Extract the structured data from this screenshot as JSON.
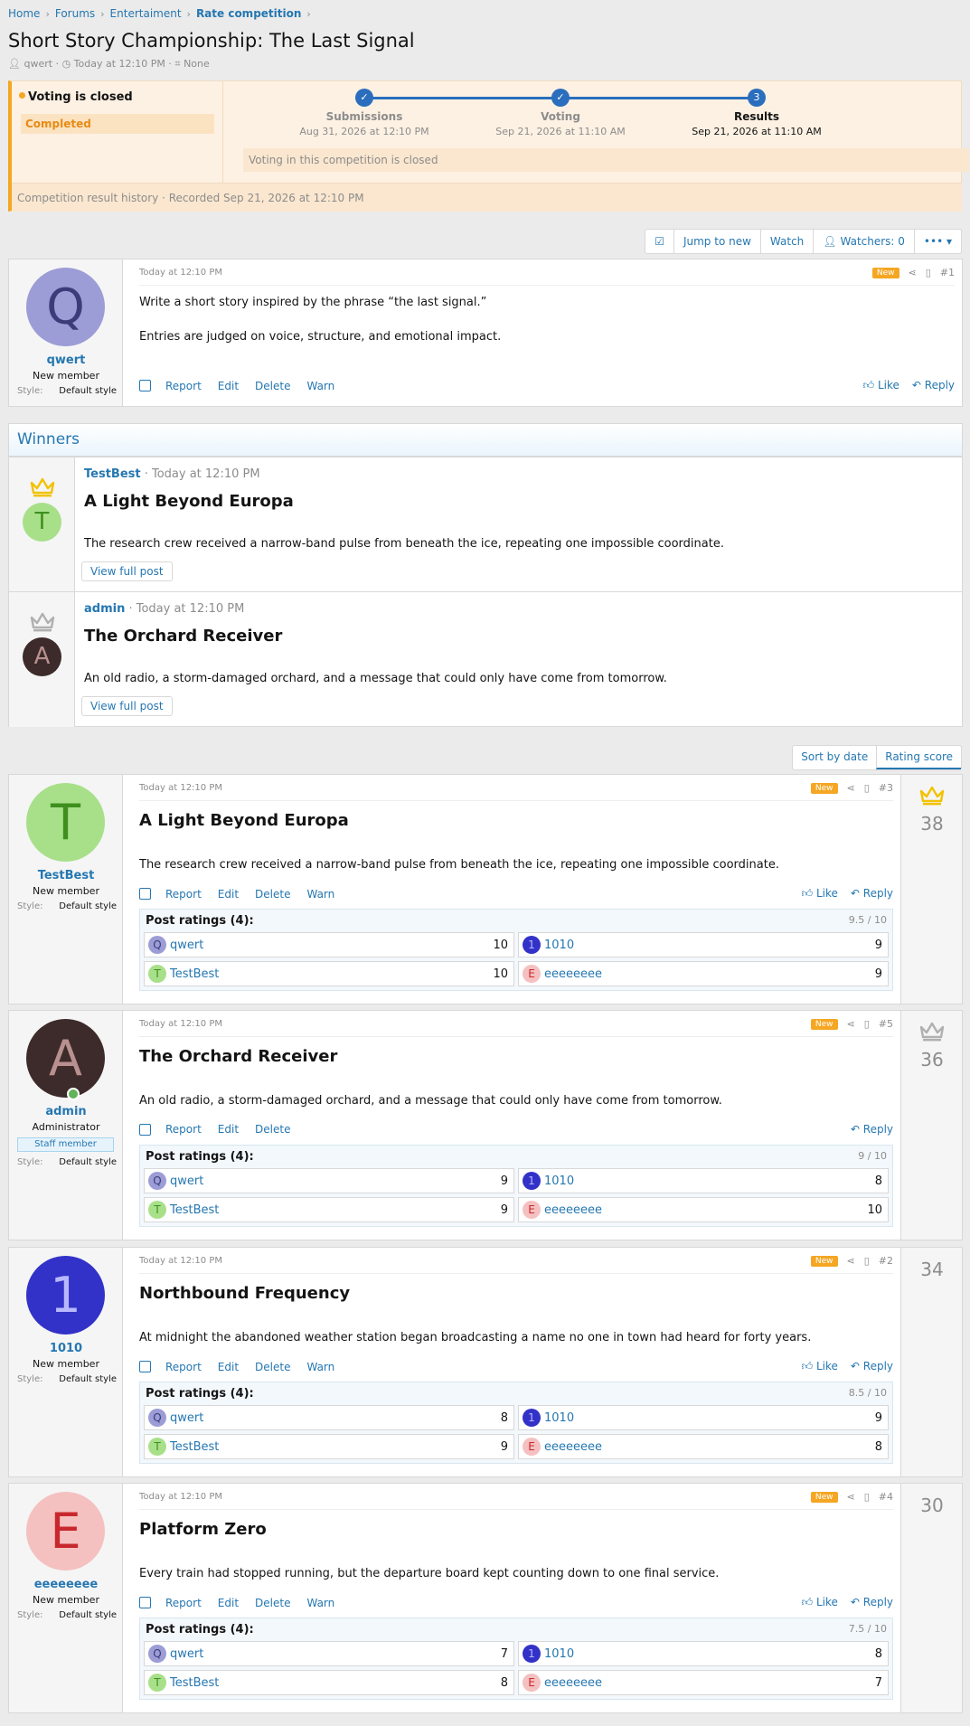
{
  "breadcrumbs": [
    "Home",
    "Forums",
    "Entertaiment",
    "Rate competition"
  ],
  "page": {
    "title": "Short Story Championship: The Last Signal",
    "author": "qwert",
    "date": "Today at 12:10 PM",
    "tags": "None"
  },
  "competition": {
    "status": "Voting is closed",
    "badge": "Completed",
    "steps": [
      {
        "num": "✓",
        "label": "Submissions",
        "date": "Aug 31, 2026 at 12:10 PM"
      },
      {
        "num": "✓",
        "label": "Voting",
        "date": "Sep 21, 2026 at 11:10 AM"
      },
      {
        "num": "3",
        "label": "Results",
        "date": "Sep 21, 2026 at 11:10 AM"
      }
    ],
    "notice": "Voting in this competition is closed",
    "history": "Competition result history · Recorded Sep 21, 2026 at 12:10 PM"
  },
  "toolbar": {
    "jump": "Jump to new",
    "watch": "Watch",
    "watchers": "Watchers: 0"
  },
  "labels": {
    "new": "New",
    "report": "Report",
    "edit": "Edit",
    "delete": "Delete",
    "warn": "Warn",
    "like": "Like",
    "reply": "Reply",
    "style": "Style:",
    "style_value": "Default style",
    "view_full": "View full post",
    "staff": "Staff member",
    "ratings_head": "Post ratings (4):"
  },
  "first_post": {
    "user": "qwert",
    "role": "New member",
    "initial": "Q",
    "date": "Today at 12:10 PM",
    "num": "#1",
    "line1": "Write a short story inspired by the phrase “the last signal.”",
    "line2": "Entries are judged on voice, structure, and emotional impact."
  },
  "winners": {
    "title": "Winners",
    "items": [
      {
        "user": "TestBest",
        "date": " · Today at 12:10 PM",
        "title": "A Light Beyond Europa",
        "text": "The research crew received a narrow-band pulse from beneath the ice, repeating one impossible coordinate.",
        "initial": "T"
      },
      {
        "user": "admin",
        "date": " · Today at 12:10 PM",
        "title": "The Orchard Receiver",
        "text": "An old radio, a storm-damaged orchard, and a message that could only have come from tomorrow.",
        "initial": "A"
      }
    ]
  },
  "sort": {
    "date": "Sort by date",
    "score": "Rating score"
  },
  "entries": [
    {
      "user": "TestBest",
      "role": "New member",
      "initial": "T",
      "date": "Today at 12:10 PM",
      "num": "#3",
      "title": "A Light Beyond Europa",
      "text": "The research crew received a narrow-band pulse from beneath the ice, repeating one impossible coordinate.",
      "score": "38",
      "avg": "9.5 / 10",
      "ratings": [
        {
          "name": "qwert",
          "init": "Q",
          "v": "10"
        },
        {
          "name": "1010",
          "init": "1",
          "v": "9"
        },
        {
          "name": "TestBest",
          "init": "T",
          "v": "10"
        },
        {
          "name": "eeeeeeee",
          "init": "E",
          "v": "9"
        }
      ]
    },
    {
      "user": "admin",
      "role": "Administrator",
      "initial": "A",
      "date": "Today at 12:10 PM",
      "num": "#5",
      "title": "The Orchard Receiver",
      "text": "An old radio, a storm-damaged orchard, and a message that could only have come from tomorrow.",
      "score": "36",
      "avg": "9 / 10",
      "ratings": [
        {
          "name": "qwert",
          "init": "Q",
          "v": "9"
        },
        {
          "name": "1010",
          "init": "1",
          "v": "8"
        },
        {
          "name": "TestBest",
          "init": "T",
          "v": "9"
        },
        {
          "name": "eeeeeeee",
          "init": "E",
          "v": "10"
        }
      ]
    },
    {
      "user": "1010",
      "role": "New member",
      "initial": "1",
      "date": "Today at 12:10 PM",
      "num": "#2",
      "title": "Northbound Frequency",
      "text": "At midnight the abandoned weather station began broadcasting a name no one in town had heard for forty years.",
      "score": "34",
      "avg": "8.5 / 10",
      "ratings": [
        {
          "name": "qwert",
          "init": "Q",
          "v": "8"
        },
        {
          "name": "1010",
          "init": "1",
          "v": "9"
        },
        {
          "name": "TestBest",
          "init": "T",
          "v": "9"
        },
        {
          "name": "eeeeeeee",
          "init": "E",
          "v": "8"
        }
      ]
    },
    {
      "user": "eeeeeeee",
      "role": "New member",
      "initial": "E",
      "date": "Today at 12:10 PM",
      "num": "#4",
      "title": "Platform Zero",
      "text": "Every train had stopped running, but the departure board kept counting down to one final service.",
      "score": "30",
      "avg": "7.5 / 10",
      "ratings": [
        {
          "name": "qwert",
          "init": "Q",
          "v": "7"
        },
        {
          "name": "1010",
          "init": "1",
          "v": "8"
        },
        {
          "name": "TestBest",
          "init": "T",
          "v": "8"
        },
        {
          "name": "eeeeeeee",
          "init": "E",
          "v": "7"
        }
      ]
    }
  ],
  "colors": {
    "Q": [
      "#9c9cd6",
      "#3c3c7a"
    ],
    "T": [
      "#a8e08a",
      "#3f8f1f"
    ],
    "A": [
      "#3d2a2a",
      "#b99090"
    ],
    "1": [
      "#3232c8",
      "#b8b8ff"
    ],
    "E": [
      "#f5c0c0",
      "#c8282d"
    ],
    "gold": "#f2c200",
    "silver": "#b0b0b0"
  }
}
